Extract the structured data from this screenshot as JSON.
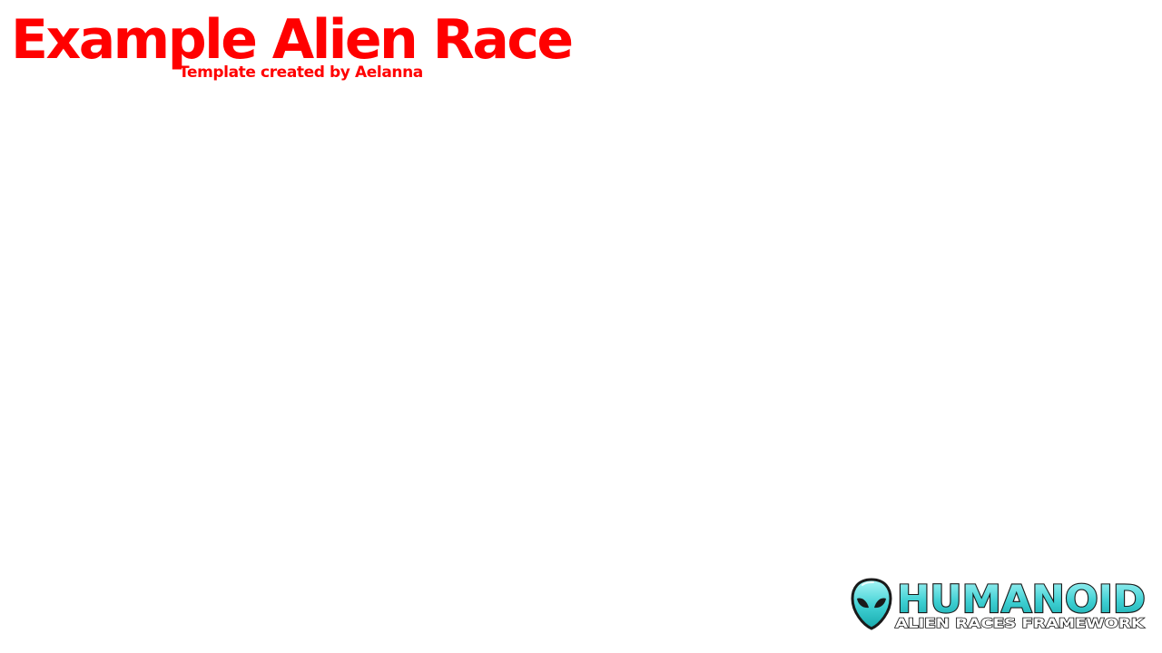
{
  "header": {
    "title": "Example Alien Race",
    "credit": "Template created by Aelanna"
  },
  "logo": {
    "wordmark": "HUMANOID",
    "tagline": "ALIEN RACES FRAMEWORK",
    "icon": "alien-head-icon"
  },
  "colors": {
    "title_red": "#ff0000",
    "logo_cyan_light": "#9ff3f4",
    "logo_cyan_dark": "#1db5b8",
    "logo_outline": "#1a1a1a"
  }
}
